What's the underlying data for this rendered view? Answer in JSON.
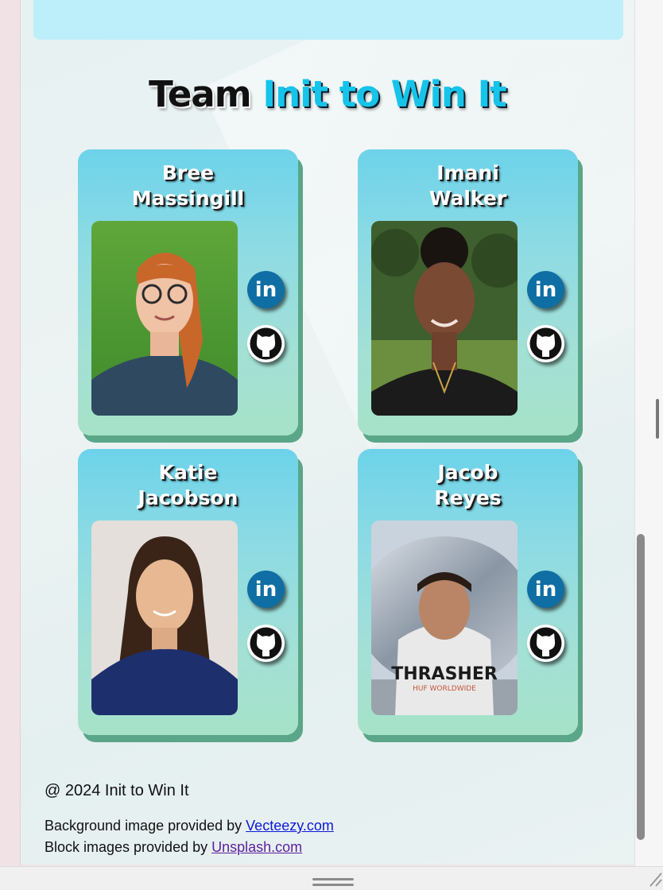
{
  "team": {
    "title_prefix": "Team",
    "title_accent": "Init to Win It"
  },
  "members": [
    {
      "first": "Bree",
      "last": "Massingill",
      "linkedin_label": "in"
    },
    {
      "first": "Imani",
      "last": "Walker",
      "linkedin_label": "in"
    },
    {
      "first": "Katie",
      "last": "Jacobson",
      "linkedin_label": "in"
    },
    {
      "first": "Jacob",
      "last": "Reyes",
      "linkedin_label": "in",
      "shirt_text": "THRASHER",
      "shirt_sub": "HUF WORLDWIDE"
    }
  ],
  "footer": {
    "copyright": "@ 2024 Init to Win It",
    "bg_credit_prefix": "Background image provided by",
    "bg_credit_link": "Vecteezy.com",
    "block_credit_prefix": "Block images provided by",
    "block_credit_link": "Unsplash.com"
  },
  "colors": {
    "accent": "#16c4ea",
    "linkedin": "#0f6ea3",
    "card_shadow": "#5aa688",
    "top_block": "#bdeffa"
  }
}
